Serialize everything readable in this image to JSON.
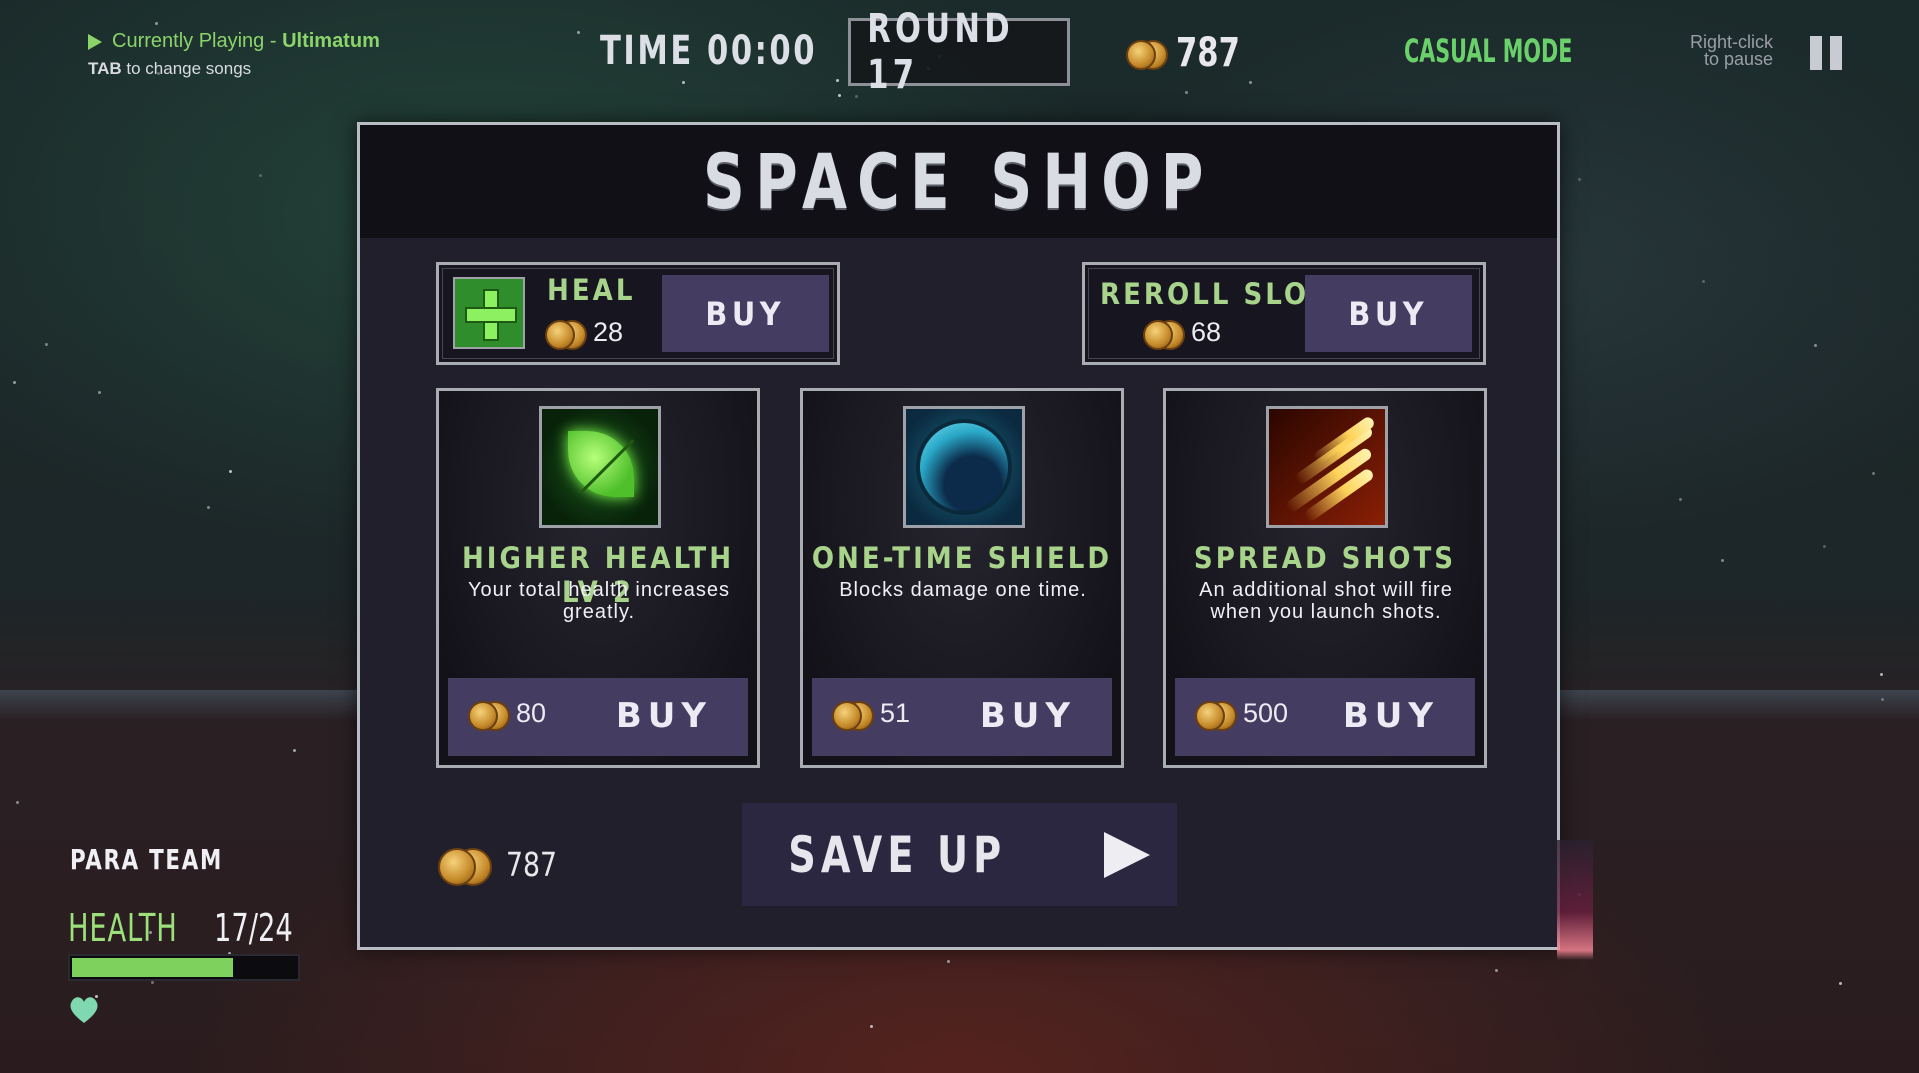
{
  "now_playing": {
    "prefix": "Currently Playing - ",
    "song": "Ultimatum",
    "hint_key": "TAB",
    "hint_text": " to change songs"
  },
  "hud": {
    "time": "TIME 00:00",
    "round": "ROUND 17",
    "coins": "787",
    "mode": "CASUAL MODE",
    "pause_hint_line1": "Right-click",
    "pause_hint_line2": "to pause"
  },
  "shop": {
    "title": "SPACE SHOP",
    "heal": {
      "name": "HEAL",
      "price": "28",
      "buy": "BUY"
    },
    "reroll": {
      "name": "REROLL SLOTS",
      "price": "68",
      "buy": "BUY"
    },
    "cards": [
      {
        "name": "HIGHER HEALTH LV 2",
        "desc": "Your total health increases greatly.",
        "price": "80",
        "buy": "BUY",
        "icon": "leaf-icon"
      },
      {
        "name": "ONE-TIME SHIELD",
        "desc": "Blocks damage one time.",
        "price": "51",
        "buy": "BUY",
        "icon": "shield-orb-icon"
      },
      {
        "name": "SPREAD SHOTS",
        "desc": "An additional shot will fire when you launch shots.",
        "price": "500",
        "buy": "BUY",
        "icon": "fire-streaks-icon"
      }
    ],
    "wallet": "787",
    "save_up": "SAVE UP"
  },
  "player": {
    "team": "PARA TEAM",
    "health_label": "HEALTH",
    "health_value": "17/24",
    "health_fraction": 0.7083,
    "lives_icon": "heart-icon"
  },
  "colors": {
    "accent_green": "#8bd36b",
    "button_purple": "#453c62",
    "panel_bg": "#211f2c"
  }
}
